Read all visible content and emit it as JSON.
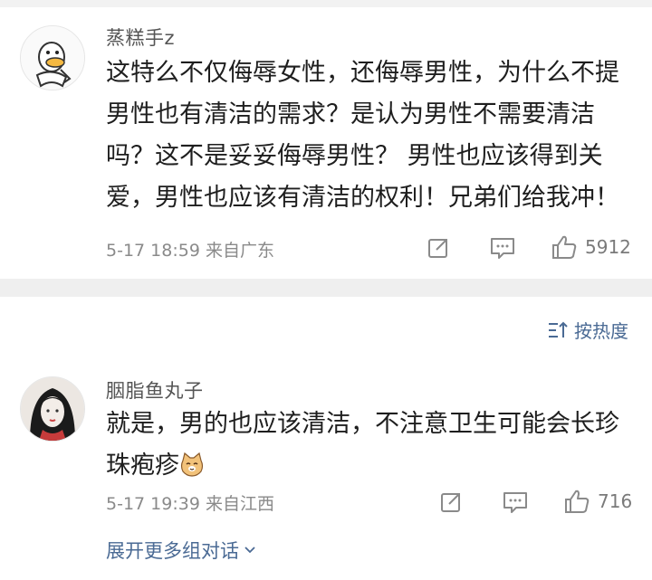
{
  "post": {
    "username": "蒸糕手z",
    "content": "这特么不仅侮辱女性，还侮辱男性，为什么不提男性也有清洁的需求？是认为男性不需要清洁吗？这不是妥妥侮辱男性？ 男性也应该得到关爱，男性也应该有清洁的权利！兄弟们给我冲！",
    "meta": "5-17 18:59  来自广东",
    "like_count": "5912"
  },
  "sort": {
    "label": "按热度"
  },
  "reply": {
    "username": "胭脂鱼丸子",
    "content": "就是，男的也应该清洁，不注意卫生可能会长珍珠疱疹",
    "meta": "5-17 19:39  来自江西",
    "like_count": "716"
  },
  "expand": {
    "label": "展开更多组对话"
  },
  "icons": {
    "share": "share-icon",
    "comment": "comment-icon",
    "like": "thumbs-up-icon",
    "sort": "sort-icon",
    "chevron": "chevron-down-icon",
    "emoji": "cat-emoji-icon"
  },
  "colors": {
    "link": "#4a6a94",
    "meta": "#8a8a8a",
    "divider": "#efefef"
  }
}
